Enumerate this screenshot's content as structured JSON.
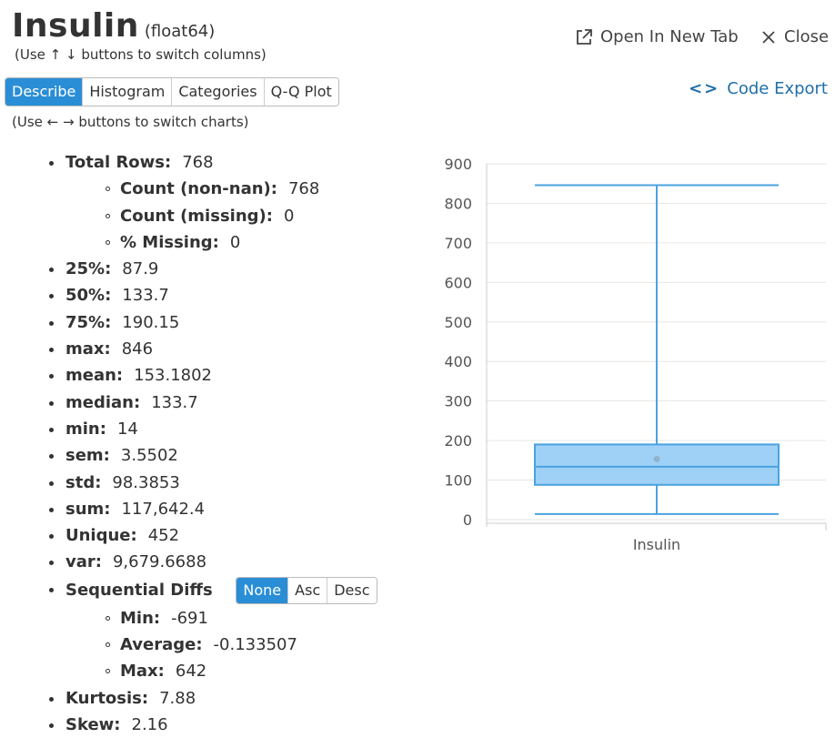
{
  "header": {
    "column_name": "Insulin",
    "dtype": "(float64)",
    "column_hint": "(Use ↑ ↓ buttons to switch columns)",
    "open_new_tab": "Open In New Tab",
    "close": "Close",
    "code_export": "Code Export"
  },
  "tabs": [
    {
      "label": "Describe",
      "active": true
    },
    {
      "label": "Histogram",
      "active": false
    },
    {
      "label": "Categories",
      "active": false
    },
    {
      "label": "Q-Q Plot",
      "active": false
    }
  ],
  "chart_hint": "(Use ← → buttons to switch charts)",
  "stats": {
    "total_rows": {
      "label": "Total Rows:",
      "value": "768"
    },
    "count_nonnan": {
      "label": "Count (non-nan):",
      "value": "768"
    },
    "count_missing": {
      "label": "Count (missing):",
      "value": "0"
    },
    "pct_missing": {
      "label": "% Missing:",
      "value": "0"
    },
    "p25": {
      "label": "25%:",
      "value": "87.9"
    },
    "p50": {
      "label": "50%:",
      "value": "133.7"
    },
    "p75": {
      "label": "75%:",
      "value": "190.15"
    },
    "max": {
      "label": "max:",
      "value": "846"
    },
    "mean": {
      "label": "mean:",
      "value": "153.1802"
    },
    "median": {
      "label": "median:",
      "value": "133.7"
    },
    "min": {
      "label": "min:",
      "value": "14"
    },
    "sem": {
      "label": "sem:",
      "value": "3.5502"
    },
    "std": {
      "label": "std:",
      "value": "98.3853"
    },
    "sum": {
      "label": "sum:",
      "value": "117,642.4"
    },
    "unique": {
      "label": "Unique:",
      "value": "452"
    },
    "var": {
      "label": "var:",
      "value": "9,679.6688"
    },
    "seq_diffs": {
      "label": "Sequential Diffs",
      "buttons": [
        "None",
        "Asc",
        "Desc"
      ],
      "min": {
        "label": "Min:",
        "value": "-691"
      },
      "average": {
        "label": "Average:",
        "value": "-0.133507"
      },
      "max": {
        "label": "Max:",
        "value": "642"
      }
    },
    "kurtosis": {
      "label": "Kurtosis:",
      "value": "7.88"
    },
    "skew": {
      "label": "Skew:",
      "value": "2.16"
    }
  },
  "colors": {
    "accent": "#2a8ed6",
    "box_fill": "#9fd0f5",
    "box_stroke": "#4aa3df",
    "link": "#1f6fa8"
  },
  "chart_data": {
    "type": "box",
    "categories": [
      "Insulin"
    ],
    "whisker_low": 14,
    "q1": 87.9,
    "median": 133.7,
    "q3": 190.15,
    "whisker_high": 846,
    "mean": 153.1802,
    "ylim": [
      0,
      900
    ],
    "yticks": [
      0,
      100,
      200,
      300,
      400,
      500,
      600,
      700,
      800,
      900
    ],
    "grid": true
  }
}
